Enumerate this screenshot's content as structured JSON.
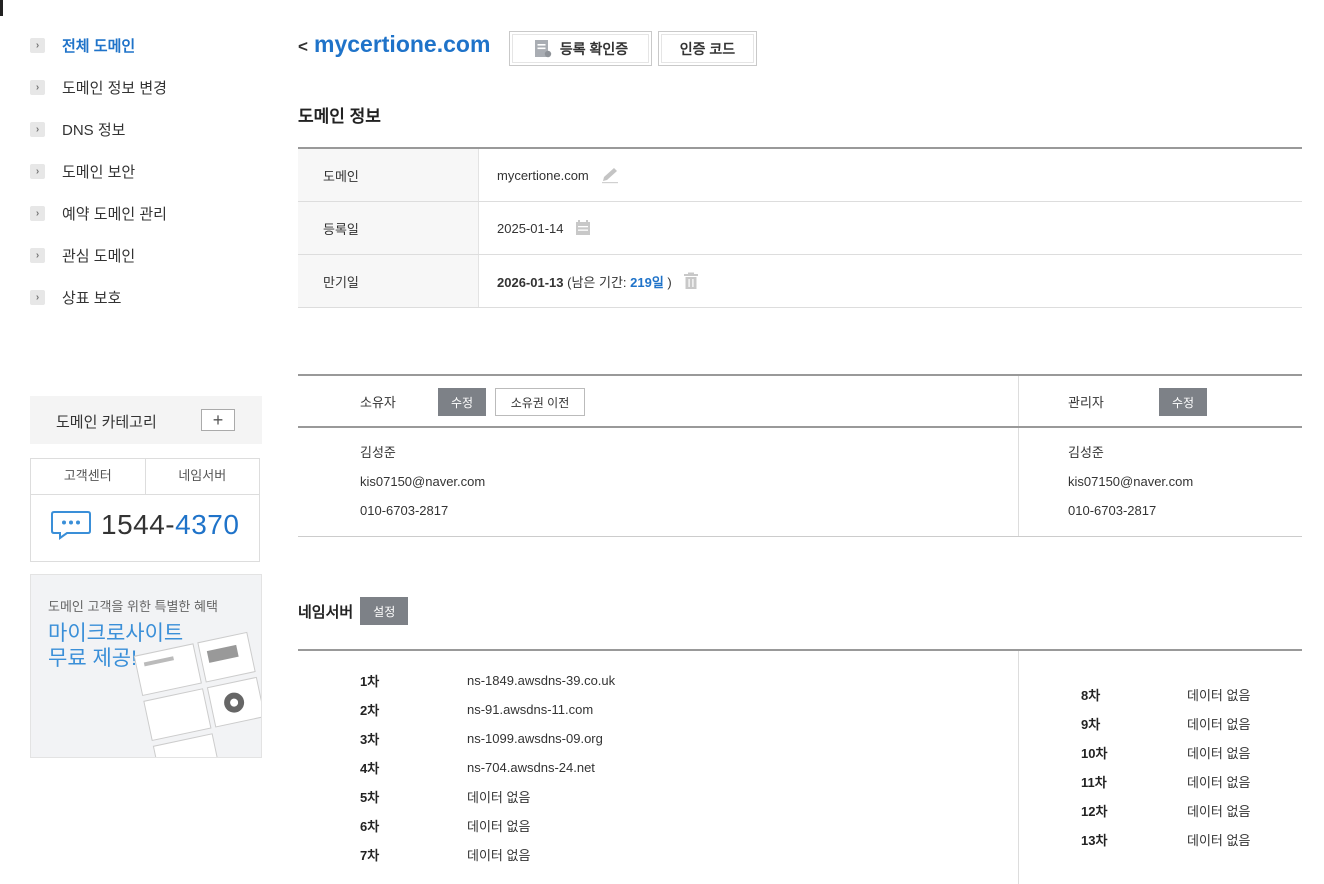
{
  "sidebar": {
    "items": [
      {
        "label": "전체 도메인",
        "active": true
      },
      {
        "label": "도메인 정보 변경",
        "active": false
      },
      {
        "label": "DNS 정보",
        "active": false
      },
      {
        "label": "도메인 보안",
        "active": false
      },
      {
        "label": "예약 도메인 관리",
        "active": false
      },
      {
        "label": "관심 도메인",
        "active": false
      },
      {
        "label": "상표 보호",
        "active": false
      }
    ],
    "chevron": "›",
    "category": {
      "label": "도메인 카테고리",
      "add": "+"
    },
    "support": {
      "tab1": "고객센터",
      "tab2": "네임서버",
      "phone_prefix": "1544-",
      "phone_suffix": "4370"
    },
    "promo": {
      "subtitle": "도메인 고객을 위한 특별한 혜택",
      "title_line1": "마이크로사이트",
      "title_line2": "무료 제공!"
    }
  },
  "header": {
    "back": "<",
    "domain": "mycertione.com",
    "btn_register": "등록 확인증",
    "btn_authcode": "인증 코드"
  },
  "domain_info": {
    "title": "도메인 정보",
    "rows": {
      "domain": {
        "key": "도메인",
        "value": "mycertione.com"
      },
      "registered": {
        "key": "등록일",
        "value": "2025-01-14"
      },
      "expires": {
        "key": "만기일",
        "date": "2026-01-13",
        "remaining_prefix": "(남은 기간: ",
        "remaining_days": "219일",
        "remaining_suffix": " )"
      }
    }
  },
  "owner": {
    "label": "소유자",
    "edit": "수정",
    "transfer": "소유권 이전",
    "name": "김성준",
    "email": "kis07150@naver.com",
    "phone": "010-6703-2817"
  },
  "admin": {
    "label": "관리자",
    "edit": "수정",
    "name": "김성준",
    "email": "kis07150@naver.com",
    "phone": "010-6703-2817"
  },
  "nameservers": {
    "title": "네임서버",
    "setup": "설정",
    "left": [
      {
        "k": "1차",
        "v": "ns-1849.awsdns-39.co.uk"
      },
      {
        "k": "2차",
        "v": "ns-91.awsdns-11.com"
      },
      {
        "k": "3차",
        "v": "ns-1099.awsdns-09.org"
      },
      {
        "k": "4차",
        "v": "ns-704.awsdns-24.net"
      },
      {
        "k": "5차",
        "v": "데이터 없음"
      },
      {
        "k": "6차",
        "v": "데이터 없음"
      },
      {
        "k": "7차",
        "v": "데이터 없음"
      }
    ],
    "right": [
      {
        "k": "8차",
        "v": "데이터 없음"
      },
      {
        "k": "9차",
        "v": "데이터 없음"
      },
      {
        "k": "10차",
        "v": "데이터 없음"
      },
      {
        "k": "11차",
        "v": "데이터 없음"
      },
      {
        "k": "12차",
        "v": "데이터 없음"
      },
      {
        "k": "13차",
        "v": "데이터 없음"
      }
    ]
  },
  "colors": {
    "accent": "#1f73c9",
    "button_dark": "#7d8187"
  }
}
